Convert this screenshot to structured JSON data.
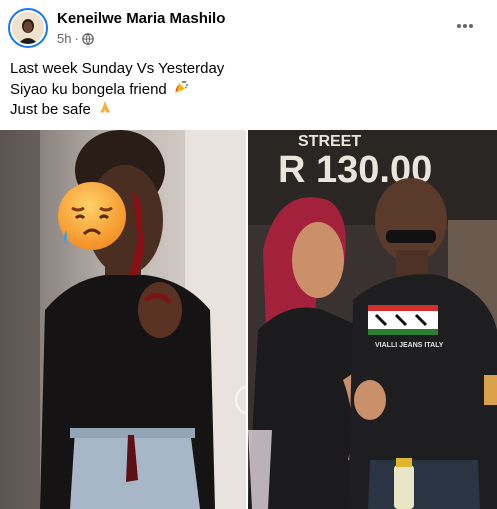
{
  "post": {
    "author": "Keneilwe Maria Mashilo",
    "time": "5h",
    "separator": "·",
    "privacy_icon": "globe-icon",
    "more_icon": "more-horizontal-icon",
    "text_lines": [
      "Last week Sunday Vs Yesterday",
      "Siyao ku bongela friend",
      "Just be safe"
    ],
    "line2_emoji": "party-popper-icon",
    "line3_emoji": "folded-hands-icon",
    "photos": {
      "left": {
        "sticker": "pensive-face-emoji"
      },
      "right": {
        "sign_text": "STREET",
        "price_text": "R 130.00",
        "shirt_text": "VIALLI JEANS ITALY"
      }
    }
  },
  "colors": {
    "accent": "#1877f2",
    "secondary_text": "#65676b",
    "primary_text": "#050505"
  }
}
